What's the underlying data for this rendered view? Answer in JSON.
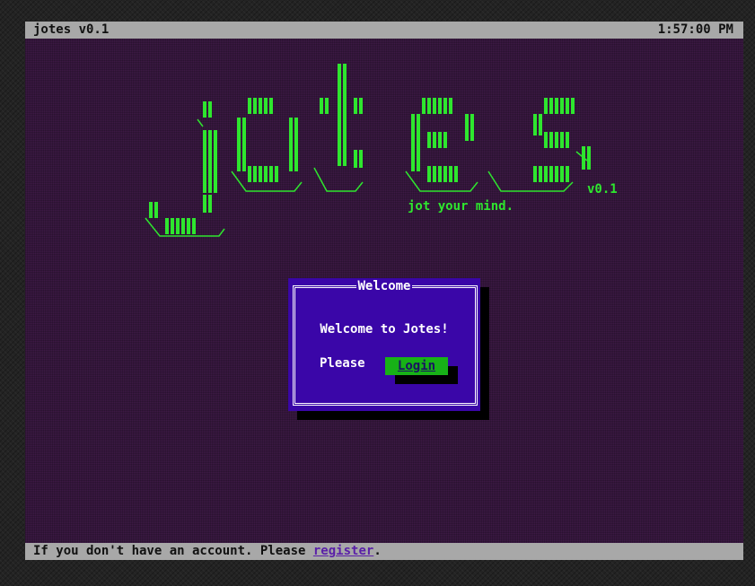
{
  "app": {
    "title": "jotes v0.1",
    "clock": "1:57:00 PM"
  },
  "logo": {
    "version": "v0.1",
    "tagline": "jot your mind."
  },
  "dialog": {
    "title": "Welcome",
    "message": "Welcome to Jotes!",
    "prompt": "Please",
    "login_label": "Login"
  },
  "footer": {
    "prefix": "If you don't have an account. Please ",
    "link": "register",
    "suffix": "."
  },
  "colors": {
    "background": "#3d1a45",
    "accent_green": "#2ee62e",
    "dialog_blue": "#3a06a8",
    "statusbar": "#a8a8a8"
  }
}
